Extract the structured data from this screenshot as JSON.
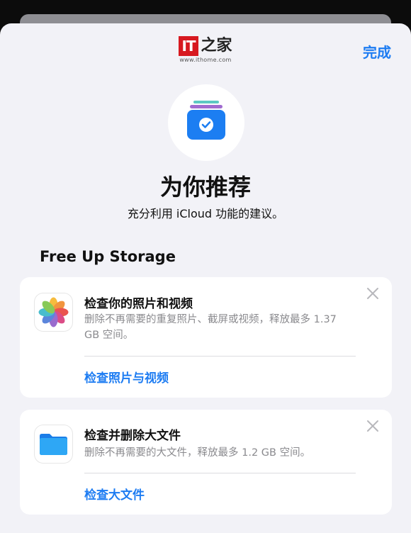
{
  "logo": {
    "mark": "IT",
    "chinese": "之家",
    "url": "www.ithome.com"
  },
  "header": {
    "done_label": "完成"
  },
  "hero": {
    "title": "为你推荐",
    "subtitle": "充分利用 iCloud 功能的建议。"
  },
  "section": {
    "heading": "Free Up Storage"
  },
  "cards": [
    {
      "title": "检查你的照片和视频",
      "description": "删除不再需要的重复照片、截屏或视频，释放最多 1.37 GB 空间。",
      "action": "检查照片与视频",
      "icon": "photos-icon"
    },
    {
      "title": "检查并删除大文件",
      "description": "删除不再需要的大文件，释放最多 1.2 GB 空间。",
      "action": "检查大文件",
      "icon": "files-folder-icon"
    }
  ],
  "colors": {
    "accent": "#1d7cf2",
    "logo_red": "#d71920",
    "sheet_bg": "#f2f2f7"
  }
}
